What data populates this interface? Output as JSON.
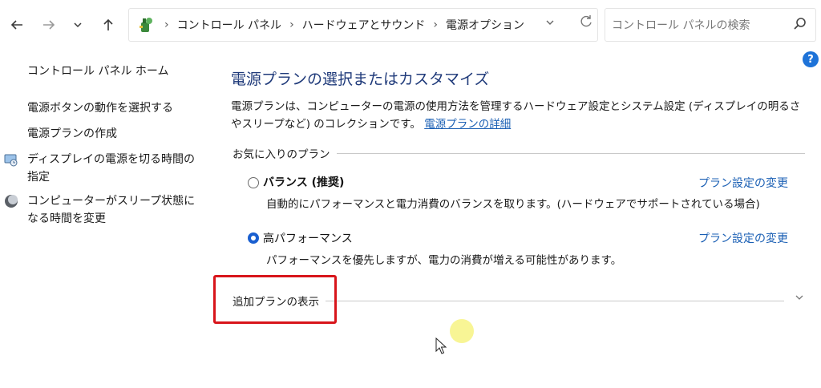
{
  "breadcrumb": [
    "コントロール パネル",
    "ハードウェアとサウンド",
    "電源オプション"
  ],
  "search": {
    "placeholder": "コントロール パネルの検索"
  },
  "sidebar": {
    "home": "コントロール パネル ホーム",
    "items": [
      {
        "label": "電源ボタンの動作を選択する"
      },
      {
        "label": "電源プランの作成"
      },
      {
        "label": "ディスプレイの電源を切る時間の指定",
        "icon": "display-power-icon"
      },
      {
        "label": "コンピューターがスリープ状態になる時間を変更",
        "icon": "sleep-moon-icon"
      }
    ]
  },
  "main": {
    "title": "電源プランの選択またはカスタマイズ",
    "description": "電源プランは、コンピューターの電源の使用方法を管理するハードウェア設定とシステム設定 (ディスプレイの明るさやスリープなど) のコレクションです。",
    "details_link": "電源プランの詳細",
    "favorites_label": "お気に入りのプラン",
    "plans": [
      {
        "name": "バランス (推奨)",
        "description": "自動的にパフォーマンスと電力消費のバランスを取ります。(ハードウェアでサポートされている場合)",
        "change_link": "プラン設定の変更",
        "selected": false
      },
      {
        "name": "高パフォーマンス",
        "description": "パフォーマンスを優先しますが、電力の消費が増える可能性があります。",
        "change_link": "プラン設定の変更",
        "selected": true
      }
    ],
    "additional_plans_label": "追加プランの表示"
  },
  "help_label": "?",
  "colors": {
    "accent": "#1a5fb4",
    "title": "#1f3a7a",
    "highlight": "#d8151b"
  }
}
